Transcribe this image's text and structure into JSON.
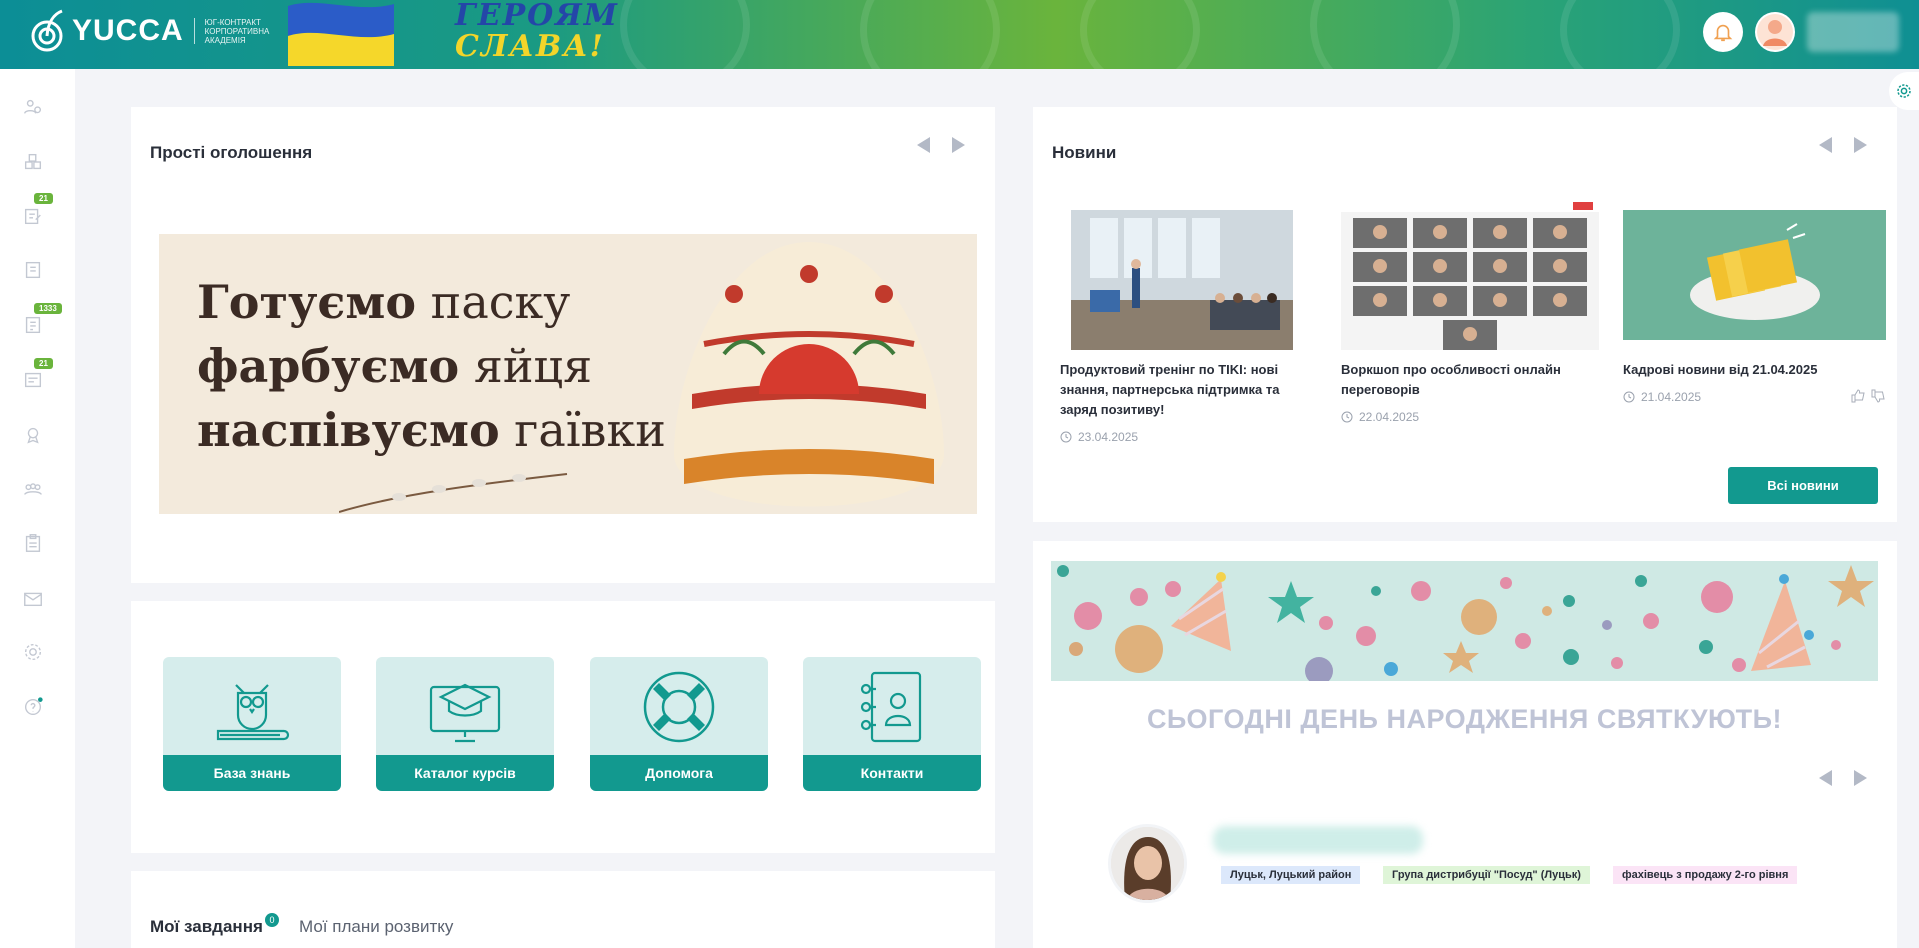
{
  "header": {
    "logo_text": "YUCCA",
    "logo_sub": "ЮГ-КОНТРАКТ КОРПОРАТИВНА АКАДЕМІЯ",
    "glory_line1": "ГЕРОЯМ",
    "glory_line2": "СЛАВА!",
    "colors": {
      "teal": "#0c8e96",
      "green": "#6ab43c",
      "blue": "#2446a8",
      "yellow": "#f2d52a"
    }
  },
  "sidebar": {
    "items": [
      {
        "icon": "users-cog-icon"
      },
      {
        "icon": "blocks-icon"
      },
      {
        "icon": "edit-doc-icon",
        "badge": "21"
      },
      {
        "icon": "book-icon"
      },
      {
        "icon": "document-icon",
        "badge": "1333"
      },
      {
        "icon": "checklist-icon",
        "badge": "21"
      },
      {
        "icon": "award-icon"
      },
      {
        "icon": "team-icon"
      },
      {
        "icon": "clipboard-icon"
      },
      {
        "icon": "mail-icon"
      },
      {
        "icon": "settings-icon"
      },
      {
        "icon": "help-icon"
      }
    ]
  },
  "announcements": {
    "title": "Прості оголошення",
    "banner_lines": [
      {
        "bold": "Готуємо",
        "rest": " паску"
      },
      {
        "bold": "фарбуємо",
        "rest": " яйця"
      },
      {
        "bold": "наспівуємо",
        "rest": " гаївки"
      }
    ]
  },
  "quick_links": [
    {
      "label": "База знань",
      "icon": "owl-book-icon"
    },
    {
      "label": "Каталог курсів",
      "icon": "graduation-monitor-icon"
    },
    {
      "label": "Допомога",
      "icon": "lifebuoy-icon"
    },
    {
      "label": "Контакти",
      "icon": "contacts-book-icon"
    }
  ],
  "tasks": {
    "tab_tasks": "Мої завдання",
    "tasks_count": "0",
    "tab_plans": "Мої плани розвитку"
  },
  "news": {
    "title": "Новини",
    "items": [
      {
        "title": "Продуктовий тренінг по TIKI: нові знання, партнерська підтримка та заряд позитиву!",
        "date": "23.04.2025"
      },
      {
        "title": "Воркшоп про особливості онлайн переговорів",
        "date": "22.04.2025"
      },
      {
        "title": "Кадрові новини від 21.04.2025",
        "date": "21.04.2025"
      }
    ],
    "all_button": "Всі новини"
  },
  "birthdays": {
    "title": "СЬОГОДНІ ДЕНЬ НАРОДЖЕННЯ СВЯТКУЮТЬ!",
    "tags": [
      {
        "text": "Луцьк, Луцький район",
        "color": "#dce8fb"
      },
      {
        "text": "Група дистрибуції \"Посуд\" (Луцьк)",
        "color": "#dff5d8"
      },
      {
        "text": "фахівець з продажу 2-го рівня",
        "color": "#fbe4f6"
      }
    ]
  }
}
